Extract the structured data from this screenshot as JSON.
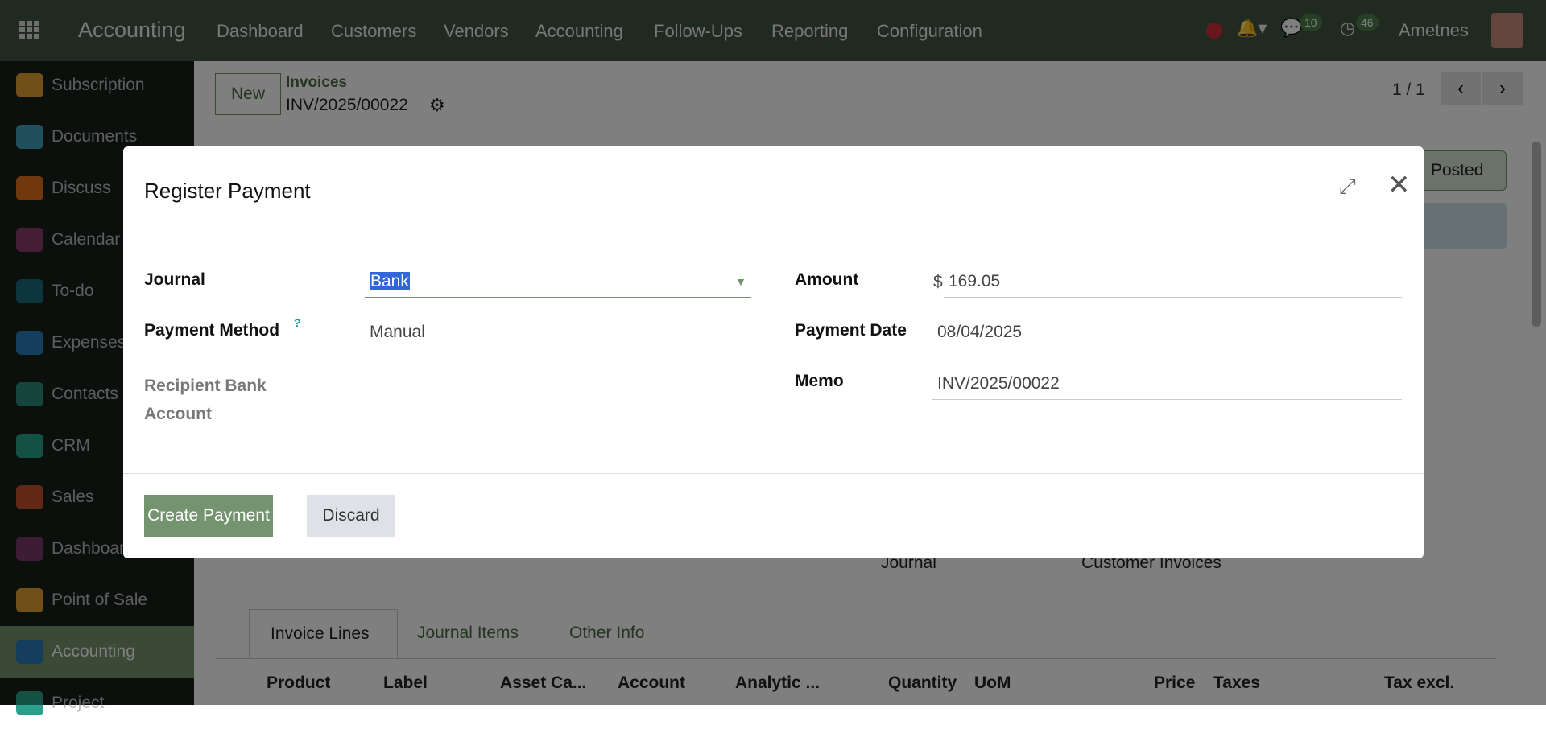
{
  "topbar": {
    "app": "Accounting",
    "menu": [
      "Dashboard",
      "Customers",
      "Vendors",
      "Accounting",
      "Follow-Ups",
      "Reporting",
      "Configuration"
    ],
    "messages_count": "10",
    "activities_count": "46",
    "user": "Ametnes"
  },
  "sidebar": [
    "Subscription",
    "Documents",
    "Discuss",
    "Calendar",
    "To-do",
    "Expenses",
    "Contacts",
    "CRM",
    "Sales",
    "Dashboards",
    "Point of Sale",
    "Accounting",
    "Project"
  ],
  "sidebar_colors": [
    "#e0a030",
    "#3fa0b8",
    "#e0701a",
    "#8a3a6a",
    "#1a6a7a",
    "#2a7ab8",
    "#2a8a7a",
    "#2aa08a",
    "#c0502a",
    "#7a3a6a",
    "#e0a030",
    "#2a7ab8",
    "#2aa08a"
  ],
  "controlpanel": {
    "new": "New",
    "breadcrumb": "Invoices",
    "record": "INV/2025/00022",
    "pager": "1 / 1",
    "status": "Posted"
  },
  "form": {
    "journal_label": "Journal",
    "journal_value": "Customer Invoices",
    "tabs": [
      "Invoice Lines",
      "Journal Items",
      "Other Info"
    ],
    "columns": [
      "Product",
      "Label",
      "Asset Ca...",
      "Account",
      "Analytic ...",
      "Quantity",
      "UoM",
      "Price",
      "Taxes",
      "Tax excl."
    ]
  },
  "modal": {
    "title": "Register Payment",
    "journal_label": "Journal",
    "journal": "Bank",
    "method_label": "Payment Method",
    "help": "?",
    "method": "Manual",
    "recipient_label": "Recipient Bank Account",
    "amount_label": "Amount",
    "currency": "$",
    "amount": "169.05",
    "date_label": "Payment Date",
    "date": "08/04/2025",
    "memo_label": "Memo",
    "memo": "INV/2025/00022",
    "create": "Create Payment",
    "discard": "Discard"
  }
}
